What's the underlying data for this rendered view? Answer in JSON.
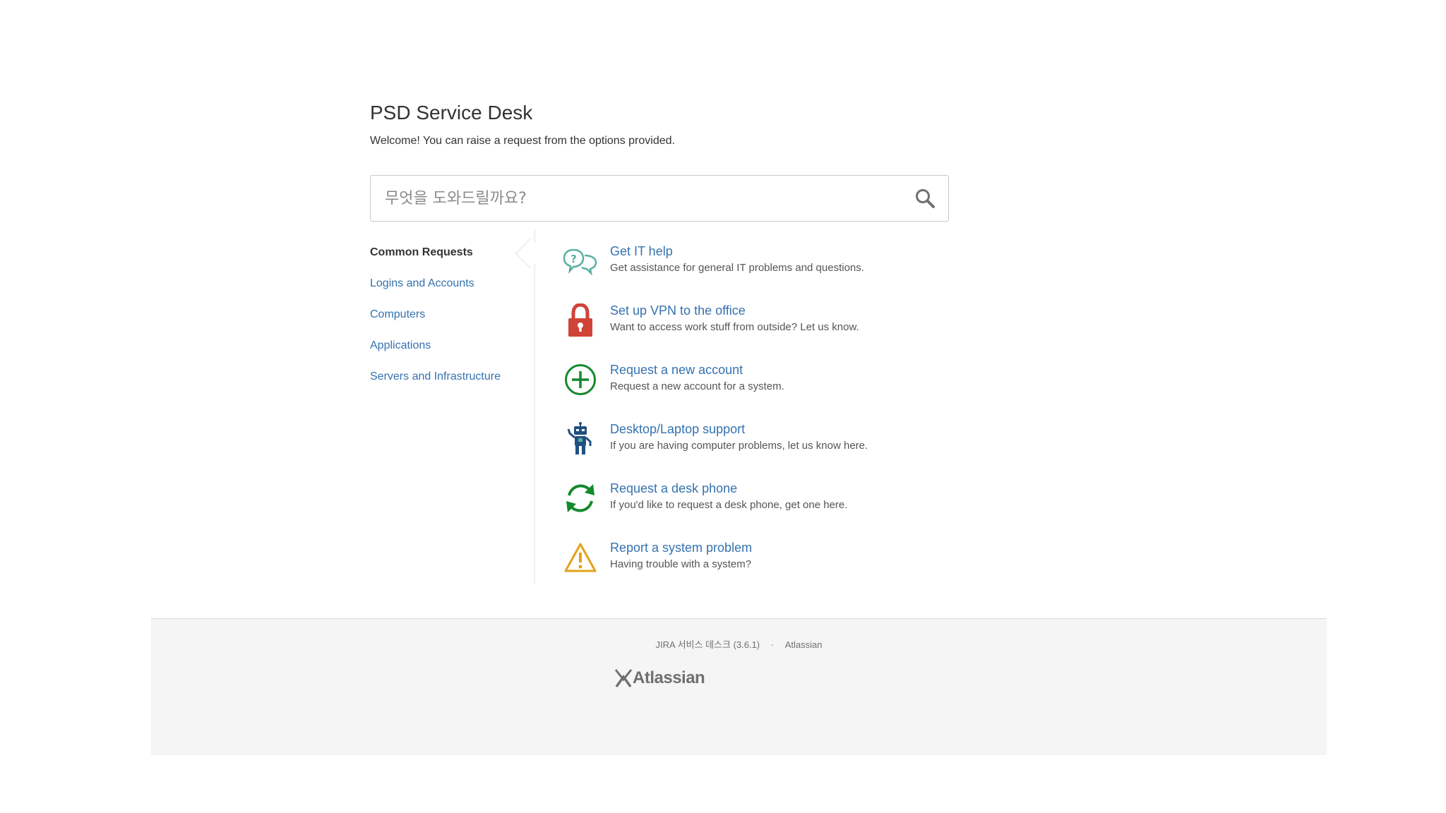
{
  "header": {
    "title": "PSD Service Desk",
    "welcome": "Welcome! You can raise a request from the options provided."
  },
  "search": {
    "placeholder": "무엇을 도와드릴까요?"
  },
  "sidebar": {
    "groups": [
      {
        "label": "Common Requests",
        "active": true
      },
      {
        "label": "Logins and Accounts"
      },
      {
        "label": "Computers"
      },
      {
        "label": "Applications"
      },
      {
        "label": "Servers and Infrastructure"
      }
    ]
  },
  "requests": [
    {
      "title": "Get IT help",
      "desc": "Get assistance for general IT problems and questions.",
      "icon": "speech-bubbles-question-icon"
    },
    {
      "title": "Set up VPN to the office",
      "desc": "Want to access work stuff from outside? Let us know.",
      "icon": "padlock-icon"
    },
    {
      "title": "Request a new account",
      "desc": "Request a new account for a system.",
      "icon": "plus-circle-icon"
    },
    {
      "title": "Desktop/Laptop support",
      "desc": "If you are having computer problems, let us know here.",
      "icon": "robot-icon"
    },
    {
      "title": "Request a desk phone",
      "desc": "If you'd like to request a desk phone, get one here.",
      "icon": "refresh-arrows-icon"
    },
    {
      "title": "Report a system problem",
      "desc": "Having trouble with a system?",
      "icon": "warning-triangle-icon"
    }
  ],
  "footer": {
    "product": "JIRA 서비스 데스크 (3.6.1)",
    "separator": "·",
    "company": "Atlassian",
    "logo_text": "Atlassian"
  },
  "colors": {
    "link": "#3572b0",
    "teal": "#59afa2",
    "red": "#d04437",
    "green": "#14892c",
    "navy": "#205081",
    "yellow": "#e3a21a"
  }
}
